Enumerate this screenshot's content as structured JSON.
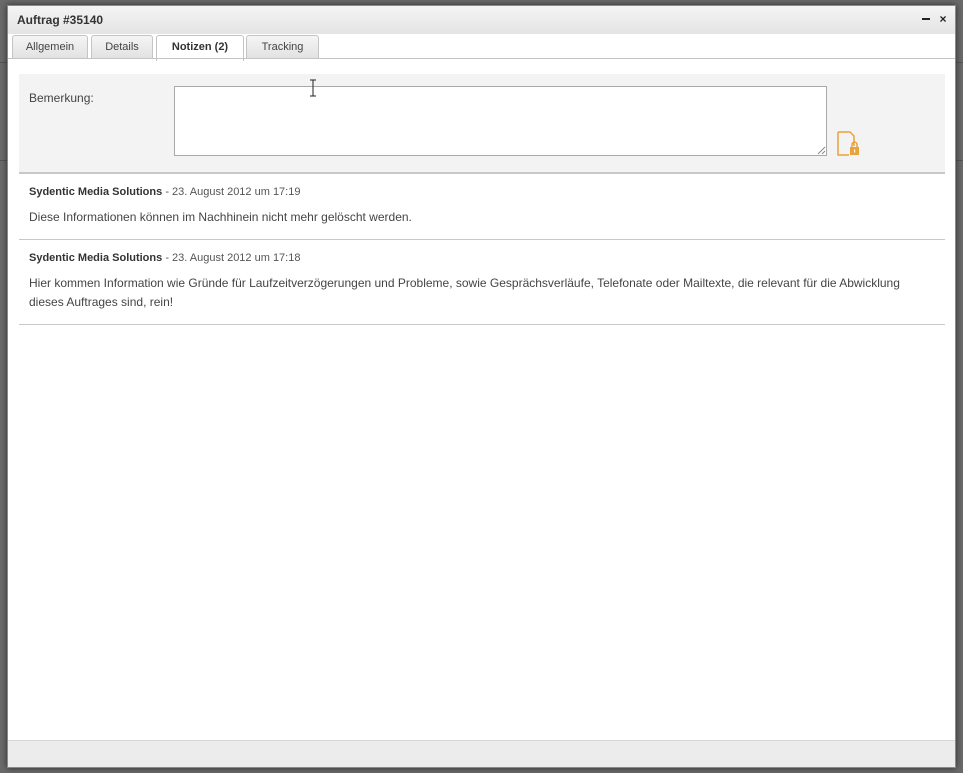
{
  "window": {
    "title": "Auftrag #35140"
  },
  "tabs": [
    {
      "label": "Allgemein"
    },
    {
      "label": "Details"
    },
    {
      "label": "Notizen (2)"
    },
    {
      "label": "Tracking"
    }
  ],
  "form": {
    "label": "Bemerkung:",
    "value": "",
    "accent_color": "#e8a33a"
  },
  "notes": [
    {
      "author": "Sydentic Media Solutions",
      "date": "- 23. August 2012 um 17:19",
      "text": "Diese Informationen können im Nachhinein nicht mehr gelöscht werden."
    },
    {
      "author": "Sydentic Media Solutions",
      "date": "- 23. August 2012 um 17:18",
      "text": "Hier kommen Information wie Gründe für Laufzeitverzögerungen und Probleme, sowie Gesprächsverläufe, Telefonate oder Mailtexte, die relevant für die Abwicklung dieses Auftrages sind, rein!"
    }
  ]
}
